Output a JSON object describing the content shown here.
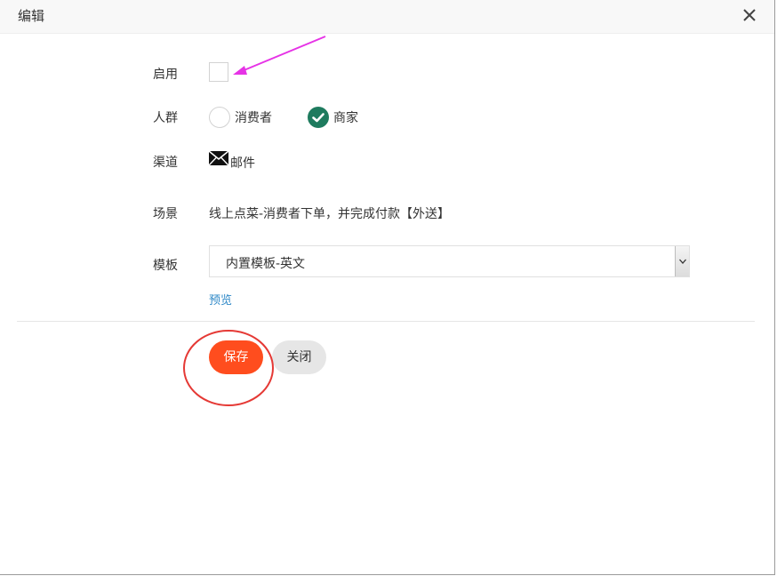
{
  "dialog": {
    "title": "编辑",
    "close_icon": "close-icon"
  },
  "form": {
    "enable": {
      "label": "启用",
      "checked": false
    },
    "audience": {
      "label": "人群",
      "options": [
        {
          "label": "消费者",
          "selected": false
        },
        {
          "label": "商家",
          "selected": true
        }
      ]
    },
    "channel": {
      "label": "渠道",
      "icon": "mail-icon",
      "value": "邮件"
    },
    "scene": {
      "label": "场景",
      "value": "线上点菜-消费者下单，并完成付款【外送】"
    },
    "template": {
      "label": "模板",
      "selected": "内置模板-英文",
      "preview_link": "预览"
    }
  },
  "actions": {
    "save_label": "保存",
    "close_label": "关闭"
  },
  "colors": {
    "save_button": "#ff4d1e",
    "radio_checked": "#1e7b5e",
    "link": "#2e88c7",
    "annotation_arrow": "#e633e6",
    "annotation_circle": "#e53935"
  }
}
